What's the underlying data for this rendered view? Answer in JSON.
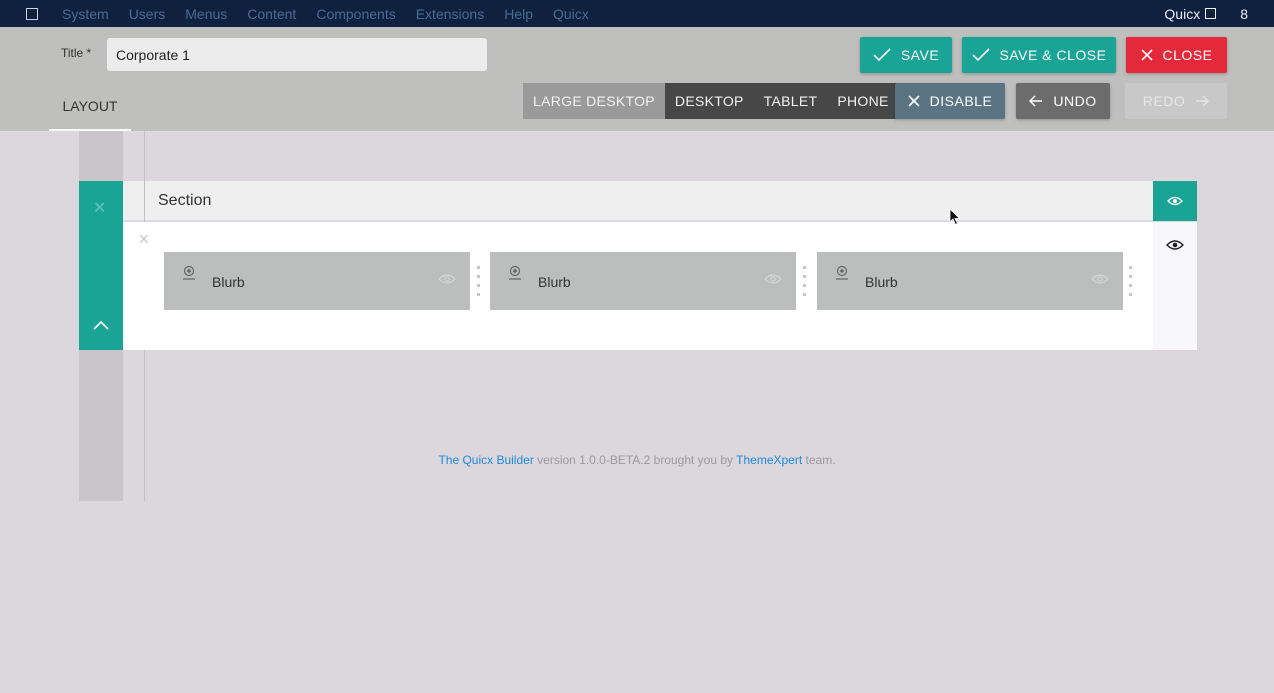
{
  "topbar": {
    "menu": [
      "System",
      "Users",
      "Menus",
      "Content",
      "Components",
      "Extensions",
      "Help",
      "Quicx"
    ],
    "right_label": "Quicx",
    "right_number": "8"
  },
  "toolbar": {
    "title_label": "Title *",
    "title_value": "Corporate 1",
    "save_label": "SAVE",
    "save_close_label": "SAVE & CLOSE",
    "close_label": "CLOSE",
    "layout_tab": "LAYOUT",
    "devices": [
      "LARGE DESKTOP",
      "DESKTOP",
      "TABLET",
      "PHONE"
    ],
    "active_device": "LARGE DESKTOP",
    "disable_label": "DISABLE",
    "undo_label": "UNDO",
    "redo_label": "REDO"
  },
  "builder": {
    "section_label": "Section",
    "blurbs": [
      "Blurb",
      "Blurb",
      "Blurb"
    ]
  },
  "footer": {
    "link1": "The Quicx Builder",
    "middle": " version 1.0.0-BETA.2 brought you by ",
    "link2": "ThemeXpert",
    "end": " team."
  },
  "colors": {
    "teal": "#1aa496",
    "red": "#e3293a",
    "navy": "#102140",
    "link": "#1e88d8"
  },
  "icons": [
    "check-icon",
    "close-icon",
    "arrow-left-icon",
    "arrow-right-icon",
    "eye-icon",
    "chevron-up-icon",
    "blurb-icon",
    "drag-handle-icon",
    "mouse-cursor"
  ]
}
